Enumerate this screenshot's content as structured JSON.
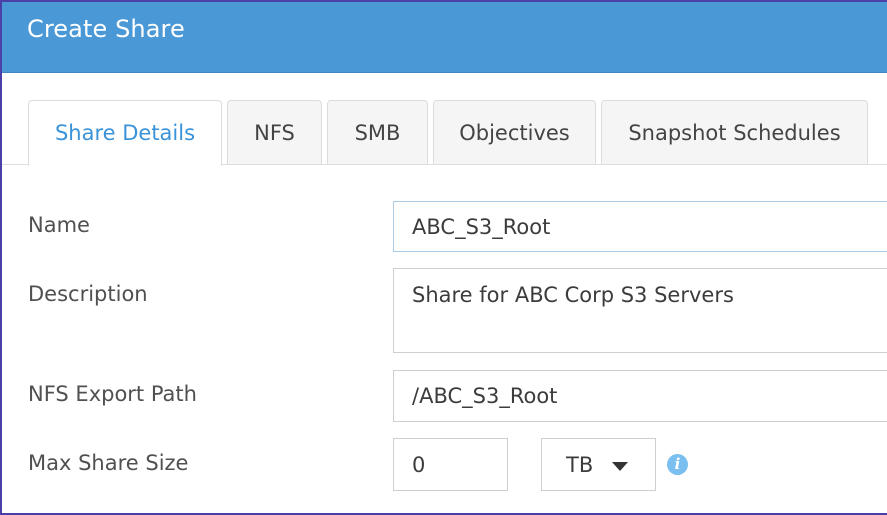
{
  "dialog": {
    "title": "Create Share"
  },
  "tabs": [
    {
      "label": "Share Details",
      "active": true
    },
    {
      "label": "NFS",
      "active": false
    },
    {
      "label": "SMB",
      "active": false
    },
    {
      "label": "Objectives",
      "active": false
    },
    {
      "label": "Snapshot Schedules",
      "active": false
    }
  ],
  "form": {
    "name": {
      "label": "Name",
      "value": "ABC_S3_Root"
    },
    "description": {
      "label": "Description",
      "value": "Share for ABC Corp S3 Servers"
    },
    "nfs_export_path": {
      "label": "NFS Export Path",
      "value": "/ABC_S3_Root"
    },
    "max_share_size": {
      "label": "Max Share Size",
      "value": "0",
      "unit": "TB"
    }
  },
  "icons": {
    "info": "info-icon",
    "dropdown": "caret-down-icon"
  },
  "colors": {
    "header_bg": "#4a98d6",
    "active_tab_text": "#3a93d8",
    "info_icon": "#7bbff0"
  }
}
